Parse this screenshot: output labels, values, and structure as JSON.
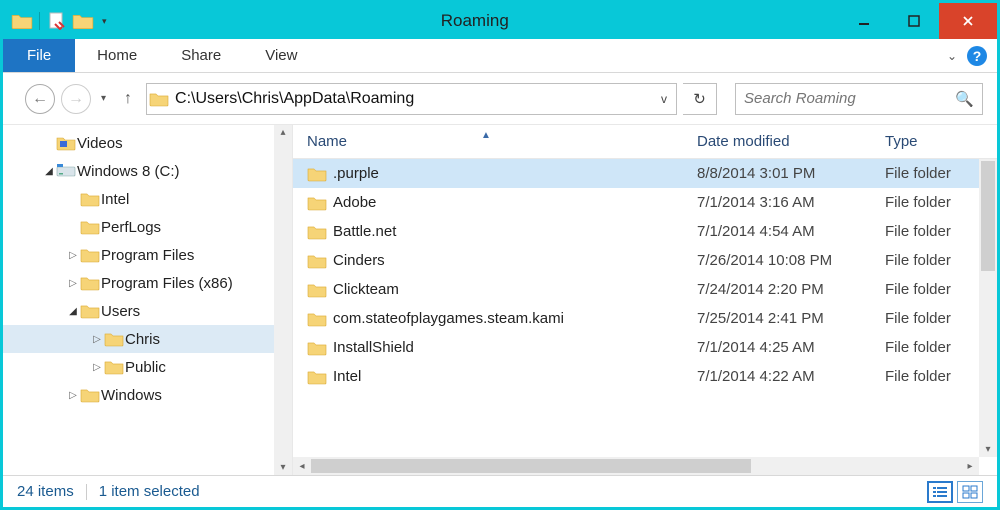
{
  "window": {
    "title": "Roaming"
  },
  "ribbon": {
    "file": "File",
    "tabs": [
      "Home",
      "Share",
      "View"
    ]
  },
  "nav": {
    "path": "C:\\Users\\Chris\\AppData\\Roaming",
    "search_placeholder": "Search Roaming"
  },
  "tree": [
    {
      "label": "Videos",
      "indent": 0,
      "icon": "videos",
      "expander": ""
    },
    {
      "label": "Windows 8 (C:)",
      "indent": 0,
      "icon": "drive",
      "expander": "open"
    },
    {
      "label": "Intel",
      "indent": 1,
      "icon": "folder",
      "expander": ""
    },
    {
      "label": "PerfLogs",
      "indent": 1,
      "icon": "folder",
      "expander": ""
    },
    {
      "label": "Program Files",
      "indent": 1,
      "icon": "folder",
      "expander": "closed"
    },
    {
      "label": "Program Files (x86)",
      "indent": 1,
      "icon": "folder",
      "expander": "closed"
    },
    {
      "label": "Users",
      "indent": 1,
      "icon": "folder",
      "expander": "open"
    },
    {
      "label": "Chris",
      "indent": 2,
      "icon": "folder",
      "expander": "closed",
      "selected": true
    },
    {
      "label": "Public",
      "indent": 2,
      "icon": "folder",
      "expander": "closed"
    },
    {
      "label": "Windows",
      "indent": 1,
      "icon": "folder",
      "expander": "closed"
    }
  ],
  "columns": {
    "name": "Name",
    "date": "Date modified",
    "type": "Type"
  },
  "rows": [
    {
      "name": ".purple",
      "date": "8/8/2014 3:01 PM",
      "type": "File folder",
      "selected": true
    },
    {
      "name": "Adobe",
      "date": "7/1/2014 3:16 AM",
      "type": "File folder"
    },
    {
      "name": "Battle.net",
      "date": "7/1/2014 4:54 AM",
      "type": "File folder"
    },
    {
      "name": "Cinders",
      "date": "7/26/2014 10:08 PM",
      "type": "File folder"
    },
    {
      "name": "Clickteam",
      "date": "7/24/2014 2:20 PM",
      "type": "File folder"
    },
    {
      "name": "com.stateofplaygames.steam.kami",
      "date": "7/25/2014 2:41 PM",
      "type": "File folder"
    },
    {
      "name": "InstallShield",
      "date": "7/1/2014 4:25 AM",
      "type": "File folder"
    },
    {
      "name": "Intel",
      "date": "7/1/2014 4:22 AM",
      "type": "File folder"
    }
  ],
  "status": {
    "count": "24 items",
    "selection": "1 item selected"
  }
}
